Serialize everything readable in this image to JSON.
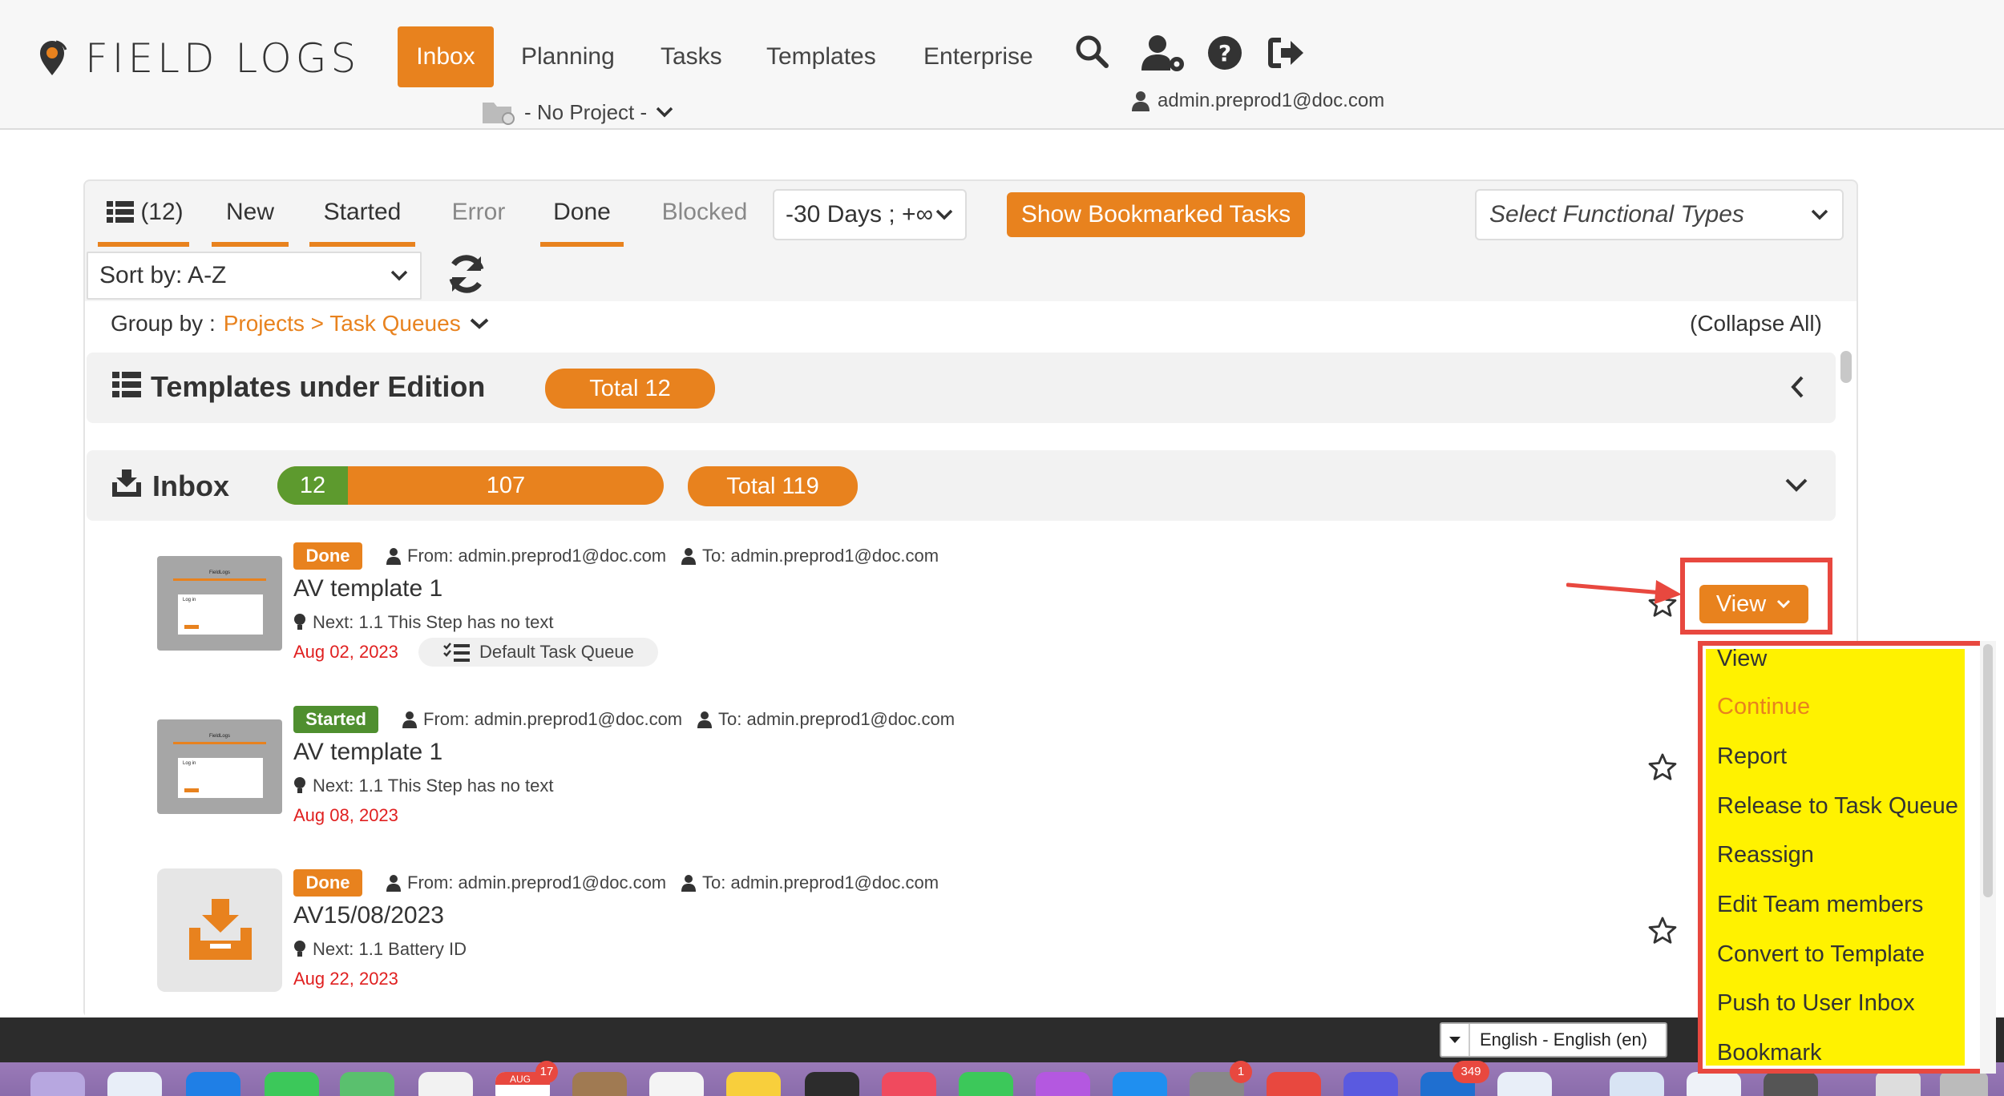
{
  "app": {
    "logo_text": "FIELD LOGS",
    "user_email": "admin.preprod1@doc.com"
  },
  "nav": {
    "items": [
      {
        "label": "Inbox",
        "active": true
      },
      {
        "label": "Planning"
      },
      {
        "label": "Tasks"
      },
      {
        "label": "Templates"
      },
      {
        "label": "Enterprise"
      }
    ],
    "project_selector": "- No Project -",
    "icons": [
      "search-icon",
      "user-settings-icon",
      "help-icon",
      "logout-icon"
    ]
  },
  "filters": {
    "count_label": "(12)",
    "tabs": [
      {
        "label": "New",
        "underlined": true
      },
      {
        "label": "Started",
        "underlined": true
      },
      {
        "label": "Error",
        "underlined": false
      },
      {
        "label": "Done",
        "underlined": true
      },
      {
        "label": "Blocked",
        "underlined": false
      }
    ],
    "date_range": "-30 Days ; +∞",
    "bookmark_button": "Show Bookmarked Tasks",
    "functional_types_placeholder": "Select Functional Types",
    "sort_label": "Sort by: A-Z",
    "group_by_label": "Group by :",
    "group_by_value": "Projects > Task Queues",
    "collapse_all": "(Collapse All)"
  },
  "groups": {
    "templates": {
      "title": "Templates under Edition",
      "total": "Total 12"
    },
    "inbox": {
      "title": "Inbox",
      "green_count": "12",
      "orange_count": "107",
      "green_fraction": 0.1,
      "total": "Total 119"
    }
  },
  "items": [
    {
      "status": "Done",
      "from": "From: admin.preprod1@doc.com",
      "to": "To: admin.preprod1@doc.com",
      "title": "AV template 1",
      "next": "Next: 1.1 This Step has no text",
      "date": "Aug 02, 2023",
      "queue": "Default Task Queue",
      "thumb_header": "FieldLogs",
      "thumb_login": "Log in"
    },
    {
      "status": "Started",
      "from": "From: admin.preprod1@doc.com",
      "to": "To: admin.preprod1@doc.com",
      "title": "AV template 1",
      "next": "Next: 1.1 This Step has no text",
      "date": "Aug 08, 2023",
      "thumb_header": "FieldLogs",
      "thumb_login": "Log in"
    },
    {
      "status": "Done",
      "from": "From: admin.preprod1@doc.com",
      "to": "To: admin.preprod1@doc.com",
      "title": "AV15/08/2023",
      "next": "Next: 1.1 Battery ID",
      "date": "Aug 22, 2023"
    }
  ],
  "view_button": "View",
  "view_menu": [
    {
      "label": "View"
    },
    {
      "label": "Continue",
      "disabled": true
    },
    {
      "label": "Report"
    },
    {
      "label": "Release to Task Queue"
    },
    {
      "label": "Reassign"
    },
    {
      "label": "Edit Team members"
    },
    {
      "label": "Convert to Template"
    },
    {
      "label": "Push to User Inbox"
    },
    {
      "label": "Bookmark"
    }
  ],
  "footer": {
    "language": "English - English (en)",
    "dock_badges": {
      "calendar_month": "AUG",
      "calendar_day": "17",
      "badge_a": "1",
      "badge_b": "349"
    }
  },
  "colors": {
    "accent": "#e8821e",
    "started": "#4f8f2f",
    "date_red": "#e02020",
    "highlight_yellow": "#fff200",
    "annotation_red": "#e8483f"
  }
}
